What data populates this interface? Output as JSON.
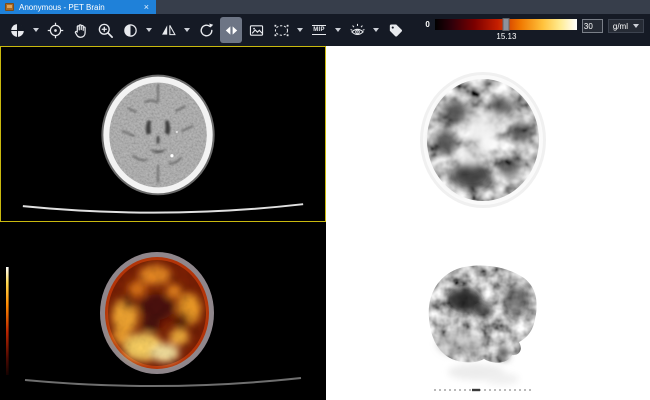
{
  "window": {
    "tab_title": "Anonymous - PET Brain",
    "close_glyph": "×"
  },
  "toolbar": {
    "tools": [
      {
        "name": "layout",
        "dropdown": true
      },
      {
        "name": "crosshair-localizer",
        "dropdown": false
      },
      {
        "name": "pan",
        "dropdown": false
      },
      {
        "name": "zoom",
        "dropdown": false
      },
      {
        "name": "window-level-contrast",
        "dropdown": true
      },
      {
        "name": "flip",
        "dropdown": true
      },
      {
        "name": "rotate",
        "dropdown": false
      },
      {
        "name": "compare-link",
        "dropdown": false,
        "active": true
      },
      {
        "name": "capture-image",
        "dropdown": false
      },
      {
        "name": "roi-ellipse",
        "dropdown": true
      },
      {
        "name": "mip",
        "dropdown": true
      },
      {
        "name": "display-settings",
        "dropdown": true
      },
      {
        "name": "tag",
        "dropdown": false
      }
    ],
    "mip_label": "MIP"
  },
  "colorbar": {
    "min_label": "0",
    "current_value": "15.13",
    "max_value": "30",
    "unit": "g/ml",
    "slider_pct": 50.4,
    "gradient_stops": [
      "#000000",
      "#7c0000",
      "#c41e00",
      "#f07800",
      "#ffc23c",
      "#ffffff"
    ]
  },
  "colors": {
    "tab_blue": "#1f81d9",
    "tabbar_bg": "#373e4b",
    "toolbar_bg": "#151a25",
    "active_tool_bg": "#6d7585",
    "selection_border": "#c9b90e"
  },
  "viewports": {
    "top_left": {
      "name": "ct-axial-view",
      "selected": true
    },
    "top_right": {
      "name": "pet-axial-view",
      "selected": false
    },
    "bottom_left": {
      "name": "fusion-axial-view",
      "selected": false
    },
    "bottom_right": {
      "name": "pet-sagittal-view",
      "selected": false
    }
  }
}
